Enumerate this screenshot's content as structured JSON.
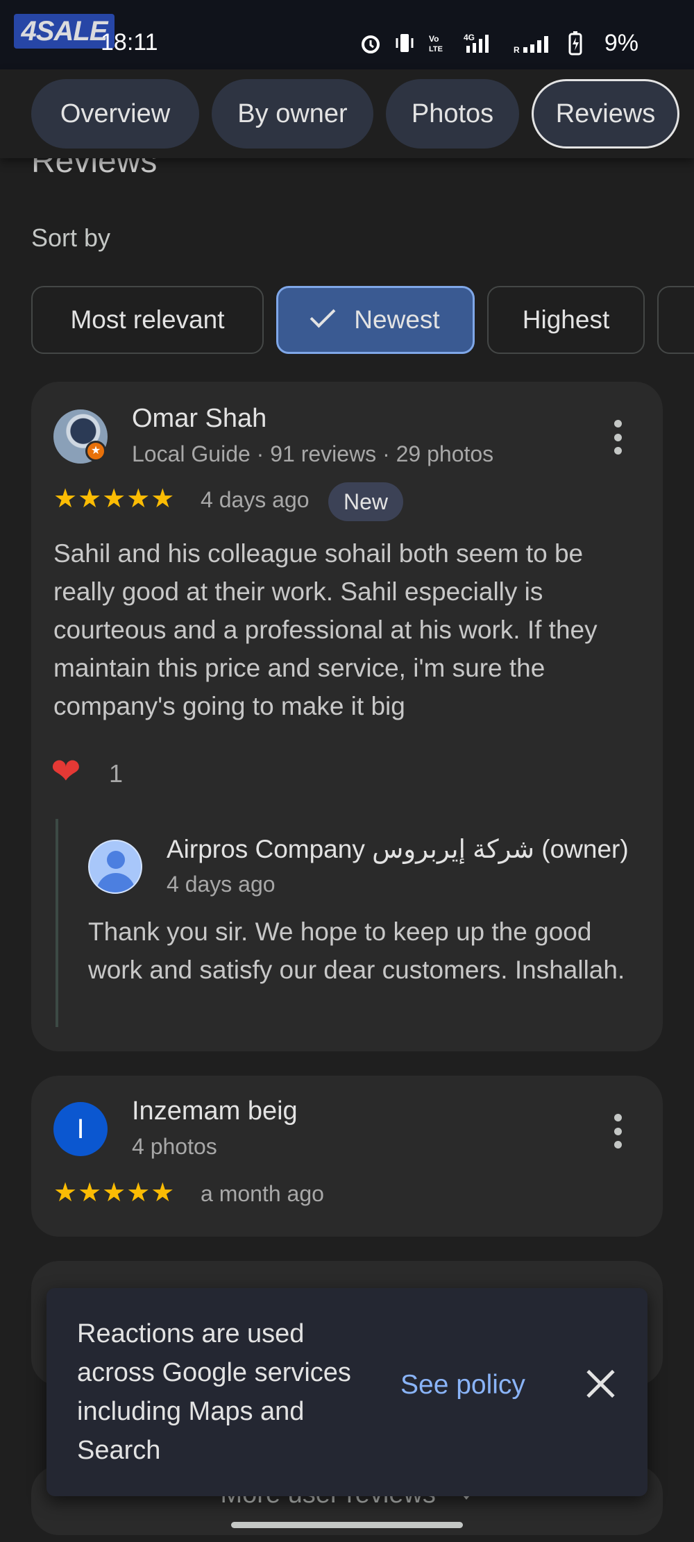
{
  "status_bar": {
    "watermark": "4SALE",
    "time": "18:11",
    "battery": "9%"
  },
  "tabs": [
    {
      "label": "Overview"
    },
    {
      "label": "By owner"
    },
    {
      "label": "Photos"
    },
    {
      "label": "Reviews",
      "selected": true
    }
  ],
  "section": {
    "heading": "Reviews",
    "sort_label": "Sort by"
  },
  "sort_chips": [
    {
      "label": "Most relevant"
    },
    {
      "label": "Newest",
      "selected": true
    },
    {
      "label": "Highest"
    }
  ],
  "reviews": [
    {
      "author": "Omar Shah",
      "meta": "Local Guide · 91 reviews · 29 photos",
      "rating": 5,
      "time": "4 days ago",
      "badge": "New",
      "text": "Sahil and his colleague sohail both seem to be really good at their work. Sahil especially is courteous and a professional at his work. If they maintain this price and service, i'm sure the company's going to make it big",
      "reaction_count": "1",
      "reply": {
        "author": "Airpros Company شركة إيربروس (owner)",
        "time": "4 days ago",
        "text": "Thank you sir. We hope to keep up the good work and satisfy our dear customers. Inshallah."
      }
    },
    {
      "author": "Inzemam beig",
      "avatar_letter": "I",
      "meta": "4 photos",
      "rating": 5,
      "time": "a month ago"
    }
  ],
  "toast": {
    "message": "Reactions are used across Google services including Maps and Search",
    "action": "See policy"
  },
  "more_reviews": "More user reviews",
  "colors": {
    "star": "#fbbc04",
    "accent_blue": "#8ab4f8",
    "selected_chip": "#3a5a92"
  }
}
